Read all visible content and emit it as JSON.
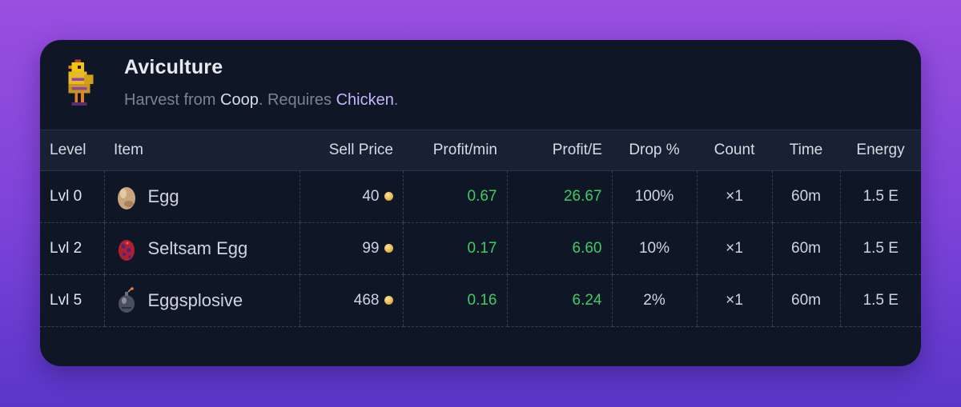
{
  "skill": {
    "title": "Aviculture",
    "subtitle_prefix": "Harvest from ",
    "source": "Coop",
    "subtitle_mid": ". Requires ",
    "requirement": "Chicken",
    "subtitle_end": ".",
    "icon": "chicken-icon"
  },
  "colors": {
    "card_bg": "#0f1727",
    "header_row_bg": "#172133",
    "profit_green": "#3dcc62",
    "requirement_link": "#c4b5fd"
  },
  "table": {
    "columns": [
      "Level",
      "Item",
      "Sell Price",
      "Profit/min",
      "Profit/E",
      "Drop %",
      "Count",
      "Time",
      "Energy"
    ],
    "rows": [
      {
        "level": "Lvl 0",
        "item": "Egg",
        "icon": "egg-icon",
        "sell_price": "40",
        "profit_min": "0.67",
        "profit_e": "26.67",
        "drop": "100%",
        "count": "×1",
        "time": "60m",
        "energy": "1.5 E"
      },
      {
        "level": "Lvl 2",
        "item": "Seltsam Egg",
        "icon": "seltsam-egg-icon",
        "sell_price": "99",
        "profit_min": "0.17",
        "profit_e": "6.60",
        "drop": "10%",
        "count": "×1",
        "time": "60m",
        "energy": "1.5 E"
      },
      {
        "level": "Lvl 5",
        "item": "Eggsplosive",
        "icon": "bomb-egg-icon",
        "sell_price": "468",
        "profit_min": "0.16",
        "profit_e": "6.24",
        "drop": "2%",
        "count": "×1",
        "time": "60m",
        "energy": "1.5 E"
      }
    ]
  }
}
